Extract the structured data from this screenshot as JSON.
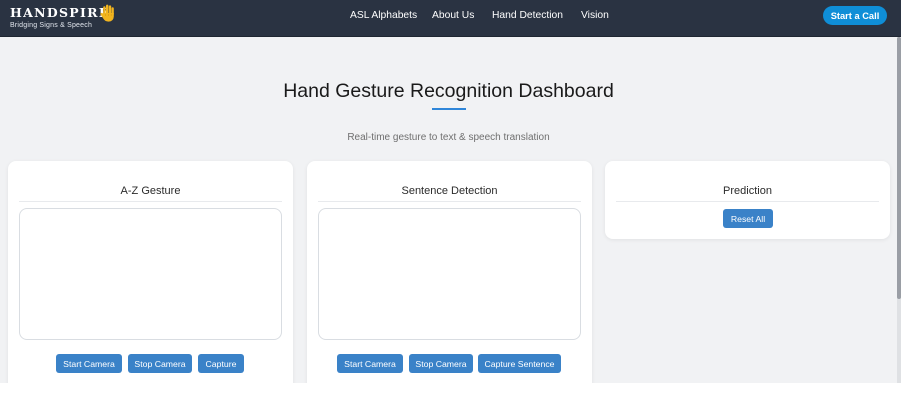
{
  "navbar": {
    "brand_name": "HANDSPIRE",
    "brand_tagline": "Bridging Signs & Speech",
    "brand_icon": "raised-hand-icon",
    "links": [
      "ASL Alphabets",
      "About Us",
      "Hand Detection",
      "Vision"
    ],
    "cta_label": "Start a Call"
  },
  "main": {
    "title": "Hand Gesture Recognition Dashboard",
    "subtitle": "Real-time gesture to text & speech translation"
  },
  "cards": {
    "az": {
      "title": "A-Z Gesture",
      "start_label": "Start Camera",
      "stop_label": "Stop Camera",
      "capture_label": "Capture"
    },
    "sentence": {
      "title": "Sentence Detection",
      "start_label": "Start Camera",
      "stop_label": "Stop Camera",
      "capture_label": "Capture Sentence"
    },
    "prediction": {
      "title": "Prediction",
      "reset_label": "Reset All"
    }
  },
  "colors": {
    "navbar": "#2a3342",
    "accent": "#3a82c8",
    "cta": "#0f8ed7",
    "background": "#f1f2f4"
  }
}
